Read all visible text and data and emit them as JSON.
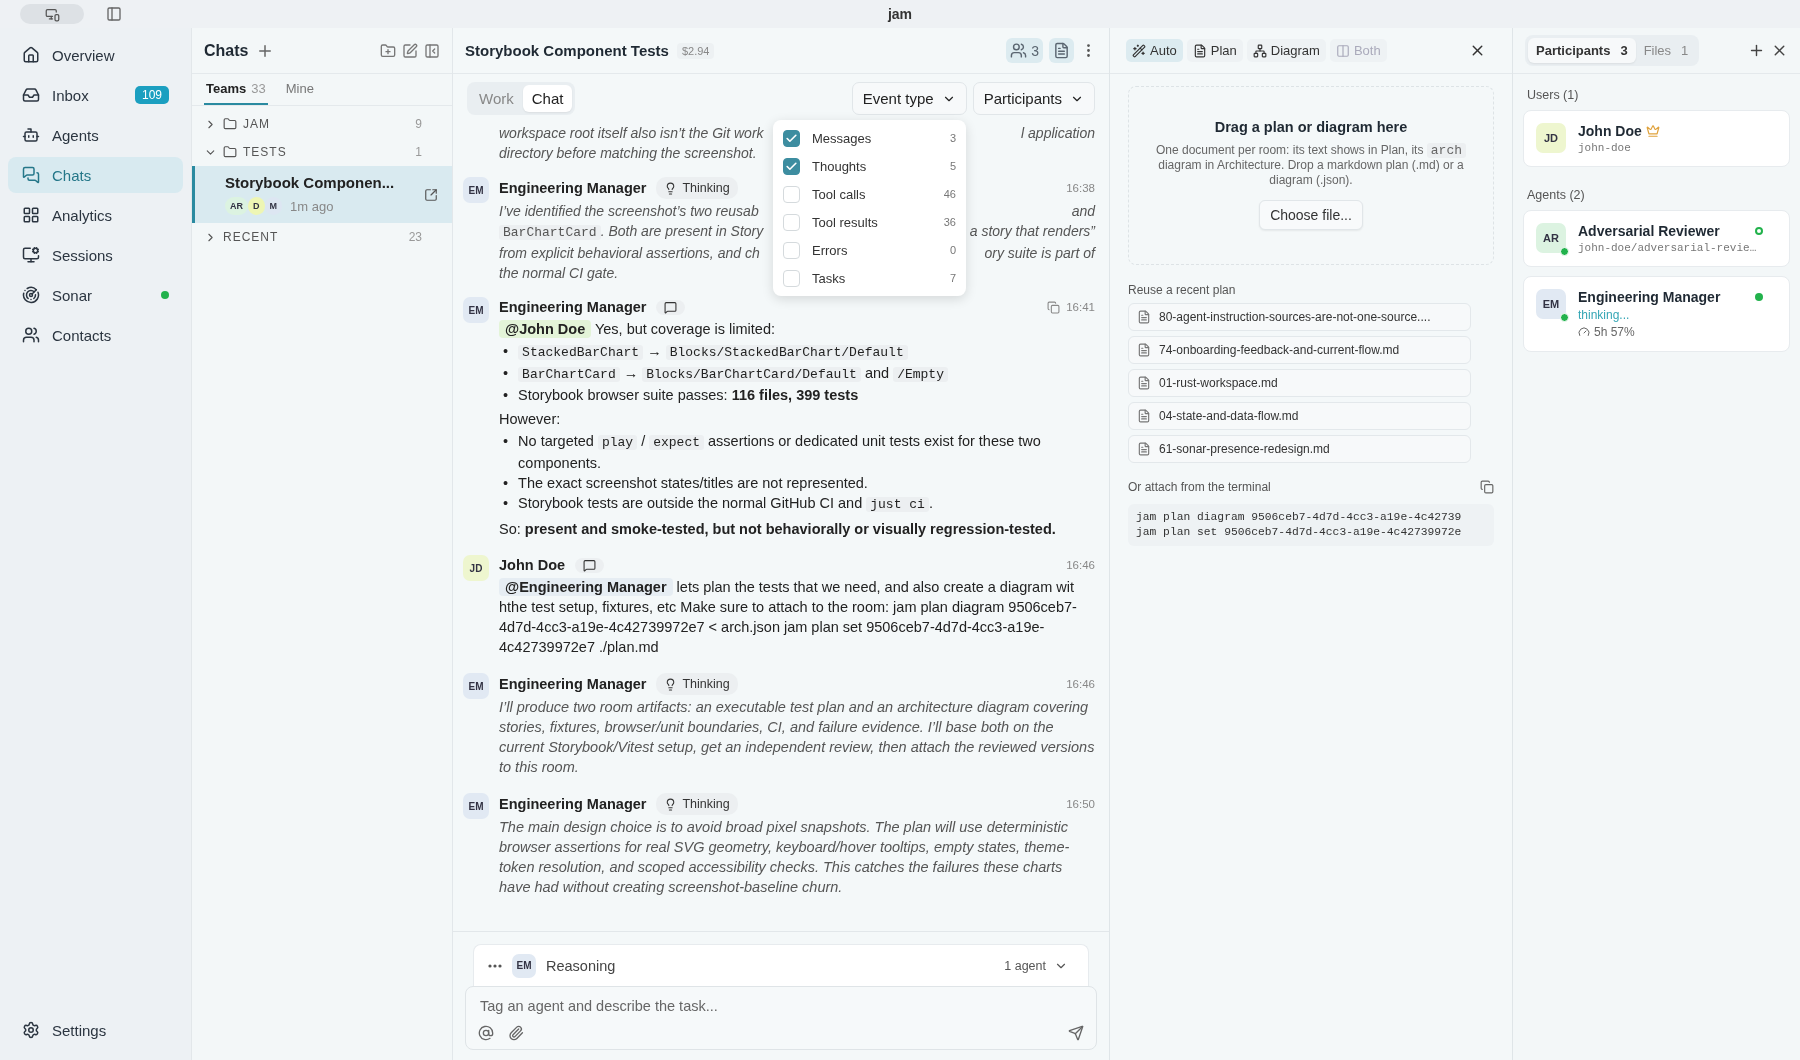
{
  "titlebar": {
    "title": "jam"
  },
  "nav": {
    "items": [
      {
        "label": "Overview",
        "selected": false
      },
      {
        "label": "Inbox",
        "badge": "109",
        "selected": false
      },
      {
        "label": "Agents",
        "selected": false
      },
      {
        "label": "Chats",
        "selected": true
      },
      {
        "label": "Analytics",
        "selected": false
      },
      {
        "label": "Sessions",
        "selected": false
      },
      {
        "label": "Sonar",
        "online": true,
        "selected": false
      },
      {
        "label": "Contacts",
        "selected": false
      }
    ],
    "settings": "Settings"
  },
  "chats": {
    "title": "Chats",
    "tabs": [
      {
        "label": "Teams",
        "count": "33",
        "selected": true
      },
      {
        "label": "Mine",
        "selected": false
      }
    ],
    "groups": [
      {
        "label": "JAM",
        "count": "9",
        "folder": true,
        "expanded": false
      },
      {
        "label": "TESTS",
        "count": "1",
        "folder": true,
        "expanded": true,
        "children": [
          {
            "title": "Storybook Componen...",
            "time": "1m ago",
            "selected": true,
            "avatars": [
              {
                "initials": "AR",
                "color": "#dcf3e1"
              },
              {
                "initials": "D",
                "color": "#eef6b4"
              },
              {
                "initials": "M",
                "color": "#dde6f2"
              }
            ]
          }
        ]
      },
      {
        "label": "RECENT",
        "count": "23",
        "folder": false,
        "expanded": false
      }
    ]
  },
  "chat": {
    "title": "Storybook Component Tests",
    "cost": "$2.94",
    "participant_count": "3",
    "view_tabs": [
      {
        "label": "Work",
        "selected": false
      },
      {
        "label": "Chat",
        "selected": true
      }
    ],
    "filters": [
      "Event type",
      "Participants"
    ],
    "event_menu": {
      "open": true,
      "items": [
        {
          "label": "Messages",
          "count": "3",
          "checked": true
        },
        {
          "label": "Thoughts",
          "count": "5",
          "checked": true
        },
        {
          "label": "Tool calls",
          "count": "46",
          "checked": false
        },
        {
          "label": "Tool results",
          "count": "36",
          "checked": false
        },
        {
          "label": "Errors",
          "count": "0",
          "checked": false
        },
        {
          "label": "Tasks",
          "count": "7",
          "checked": false
        }
      ]
    },
    "messages": [
      {
        "kind": "thought",
        "lines": [
          {
            "left": [
              {
                "kind": "text",
                "text": "workspace root itself also isn’t the Git work"
              }
            ],
            "right": "l application"
          },
          {
            "left": [
              {
                "kind": "text",
                "text": "directory before matching the screenshot."
              }
            ]
          }
        ]
      },
      {
        "kind": "thought",
        "initials": "EM",
        "color": "#e1e9f3",
        "author": "Engineering Manager",
        "badge": "Thinking",
        "time": "16:38",
        "lines": [
          {
            "left": [
              {
                "kind": "text",
                "text": "I’ve identified the screenshot’s two reusab"
              }
            ],
            "right": "and"
          },
          {
            "left": [
              {
                "kind": "code",
                "text": "BarChartCard"
              },
              {
                "kind": "text",
                "text": ". Both are present in Story"
              }
            ],
            "right": "a story that renders”"
          },
          {
            "left": [
              {
                "kind": "text",
                "text": "from explicit behavioral assertions, and ch"
              }
            ],
            "right": "ory suite is part of"
          },
          {
            "left": [
              {
                "kind": "text",
                "text": "the normal CI gate."
              }
            ]
          }
        ]
      },
      {
        "kind": "message",
        "initials": "EM",
        "color": "#e1e9f3",
        "author": "Engineering Manager",
        "time": "16:41",
        "copyable": true,
        "blocks": [
          {
            "kind": "paragraph",
            "segments": [
              {
                "kind": "mention",
                "text": "@John Doe"
              },
              {
                "kind": "text",
                "text": " Yes, but coverage is limited:"
              }
            ]
          },
          {
            "kind": "list",
            "marker": "•",
            "items": [
              [
                {
                  "kind": "code",
                  "text": "StackedBarChart"
                },
                {
                  "kind": "text",
                  "text": " → "
                },
                {
                  "kind": "code",
                  "text": "Blocks/StackedBarChart/Default"
                }
              ],
              [
                {
                  "kind": "code",
                  "text": "BarChartCard"
                },
                {
                  "kind": "text",
                  "text": " → "
                },
                {
                  "kind": "code",
                  "text": "Blocks/BarChartCard/Default"
                },
                {
                  "kind": "text",
                  "text": " and "
                },
                {
                  "kind": "code",
                  "text": "/Empty"
                }
              ],
              [
                {
                  "kind": "text",
                  "text": "Storybook browser suite passes: **116 files, 399 tests**"
                }
              ]
            ]
          },
          {
            "kind": "paragraph",
            "segments": [
              {
                "kind": "text",
                "text": "However:"
              }
            ]
          },
          {
            "kind": "list",
            "marker": "•",
            "items": [
              [
                {
                  "kind": "text",
                  "text": "No targeted "
                },
                {
                  "kind": "code",
                  "text": "play"
                },
                {
                  "kind": "text",
                  "text": " / "
                },
                {
                  "kind": "code",
                  "text": "expect"
                },
                {
                  "kind": "text",
                  "text": " assertions or dedicated unit tests exist for these two components."
                }
              ],
              [
                {
                  "kind": "text",
                  "text": "The exact screenshot states/titles are not represented."
                }
              ],
              [
                {
                  "kind": "text",
                  "text": "Storybook tests are outside the normal GitHub CI and "
                },
                {
                  "kind": "code",
                  "text": "just ci"
                },
                {
                  "kind": "text",
                  "text": "."
                }
              ]
            ]
          },
          {
            "kind": "paragraph",
            "segments": [
              {
                "kind": "text",
                "text": "So: **present and smoke-tested, but not behaviorally or visually regression-tested.**"
              }
            ]
          }
        ]
      },
      {
        "kind": "message",
        "initials": "JD",
        "color": "#eef6cf",
        "author": "John Doe",
        "time": "16:46",
        "blocks": [
          {
            "kind": "paragraph",
            "segments": [
              {
                "kind": "mention",
                "text": "@Engineering Manager"
              },
              {
                "kind": "text",
                "text": " lets plan the tests that we need, and also create a diagram wit hthe test setup, fixtures, etc Make sure to attach to the room: jam plan diagram 9506ceb7-4d7d-4cc3-a19e-4c42739972e7 < arch.json jam plan set 9506ceb7-4d7d-4cc3-a19e-4c42739972e7 ./plan.md"
              }
            ]
          }
        ]
      },
      {
        "kind": "thought",
        "initials": "EM",
        "color": "#e1e9f3",
        "author": "Engineering Manager",
        "badge": "Thinking",
        "time": "16:46",
        "blocks": [
          {
            "kind": "paragraph",
            "segments": [
              {
                "kind": "text",
                "text": "I’ll produce two room artifacts: an executable test plan and an architecture diagram covering stories, fixtures, browser/unit boundaries, CI, and failure evidence. I’ll base both on the current Storybook/Vitest setup, get an independent review, then attach the reviewed versions to this room."
              }
            ]
          }
        ]
      },
      {
        "kind": "thought",
        "initials": "EM",
        "color": "#e1e9f3",
        "author": "Engineering Manager",
        "badge": "Thinking",
        "time": "16:50",
        "blocks": [
          {
            "kind": "paragraph",
            "segments": [
              {
                "kind": "text",
                "text": "The main design choice is to avoid broad pixel snapshots. The plan will use deterministic browser assertions for real SVG geometry, keyboard/hover tooltips, empty states, theme-token resolution, and scoped accessibility checks. This catches the failures these charts have had without creating screenshot-baseline churn."
              }
            ]
          }
        ]
      }
    ],
    "composer": {
      "avatar": "EM",
      "status": "Reasoning",
      "agents": "1 agent",
      "placeholder": "Tag an agent and describe the task..."
    }
  },
  "plan": {
    "modes": [
      {
        "label": "Auto",
        "selected": true,
        "disabled": false
      },
      {
        "label": "Plan",
        "selected": false,
        "disabled": false
      },
      {
        "label": "Diagram",
        "selected": false,
        "disabled": false
      },
      {
        "label": "Both",
        "selected": false,
        "disabled": true
      }
    ],
    "drop_title": "Drag a plan or diagram here",
    "drop_text": [
      {
        "kind": "text",
        "text": "One document per room: its text shows in Plan, its "
      },
      {
        "kind": "code",
        "text": "arch"
      },
      {
        "kind": "text",
        "text": " diagram in Architecture. Drop a markdown plan (.md) or a diagram (.json)."
      }
    ],
    "choose_button": "Choose file...",
    "recent_title": "Reuse a recent plan",
    "recent": [
      "80-agent-instruction-sources-are-not-one-source....",
      "74-onboarding-feedback-and-current-flow.md",
      "01-rust-workspace.md",
      "04-state-and-data-flow.md",
      "61-sonar-presence-redesign.md"
    ],
    "terminal_title": "Or attach from the terminal",
    "terminal_lines": [
      "jam plan diagram 9506ceb7-4d7d-4cc3-a19e-4c42739",
      "jam plan set 9506ceb7-4d7d-4cc3-a19e-4c42739972e"
    ]
  },
  "people": {
    "tabs": [
      {
        "label": "Participants",
        "count": "3",
        "selected": true
      },
      {
        "label": "Files",
        "count": "1",
        "selected": false
      }
    ],
    "sections": [
      {
        "title": "Users (1)",
        "members": [
          {
            "initials": "JD",
            "color": "#eef6cf",
            "name": "John Doe",
            "owner": true,
            "handle": "john-doe"
          }
        ]
      },
      {
        "title": "Agents (2)",
        "members": [
          {
            "initials": "AR",
            "color": "#dcf3e1",
            "name": "Adversarial Reviewer",
            "presence": true,
            "busy": false,
            "handle": "john-doe/adversarial-revie…"
          },
          {
            "initials": "EM",
            "color": "#e1e9f3",
            "name": "Engineering Manager",
            "presence": true,
            "busy": true,
            "activity": "thinking...",
            "usage": "5h 57%"
          }
        ]
      }
    ]
  }
}
